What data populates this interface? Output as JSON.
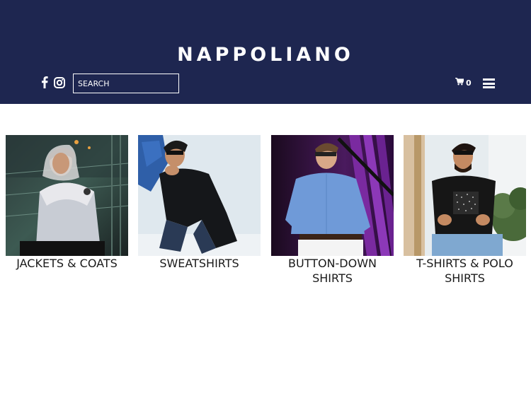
{
  "header": {
    "logo": "NAPPOLIANO",
    "search_placeholder": "SEARCH",
    "cart_count": "0",
    "background_color": "#1e2650"
  },
  "icons": {
    "facebook": "facebook-icon",
    "instagram": "instagram-icon",
    "cart": "cart-icon",
    "menu": "hamburger-menu-icon"
  },
  "categories": [
    {
      "label": "JACKETS & COATS"
    },
    {
      "label": "SWEATSHIRTS"
    },
    {
      "label": "BUTTON-DOWN SHIRTS"
    },
    {
      "label": "T-SHIRTS & POLO SHIRTS"
    }
  ]
}
